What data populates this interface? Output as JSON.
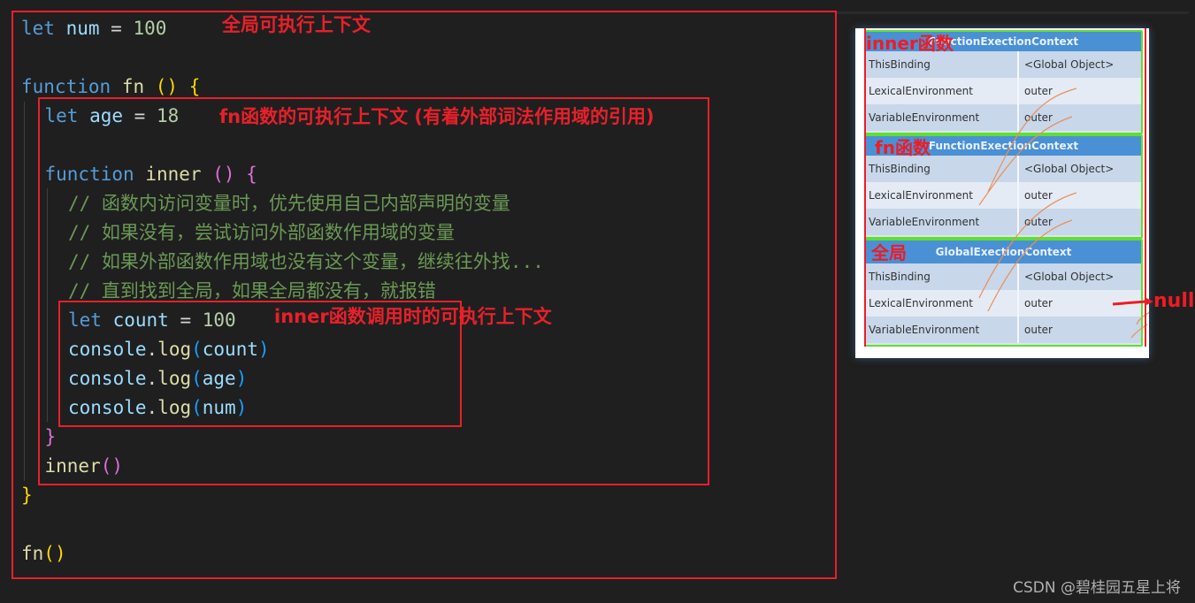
{
  "editor": {
    "lines": [
      {
        "indent": 0,
        "tokens": [
          {
            "t": "let",
            "c": "kw"
          },
          {
            "t": " "
          },
          {
            "t": "num",
            "c": "var"
          },
          {
            "t": " = "
          },
          {
            "t": "100",
            "c": "num"
          }
        ]
      },
      {
        "indent": 0,
        "tokens": []
      },
      {
        "indent": 0,
        "tokens": [
          {
            "t": "function",
            "c": "kw"
          },
          {
            "t": " "
          },
          {
            "t": "fn",
            "c": "fn"
          },
          {
            "t": " "
          },
          {
            "t": "()",
            "c": "b1"
          },
          {
            "t": " "
          },
          {
            "t": "{",
            "c": "b1"
          }
        ]
      },
      {
        "indent": 1,
        "tokens": [
          {
            "t": "let",
            "c": "kw"
          },
          {
            "t": " "
          },
          {
            "t": "age",
            "c": "var"
          },
          {
            "t": " = "
          },
          {
            "t": "18",
            "c": "num"
          }
        ]
      },
      {
        "indent": 0,
        "tokens": []
      },
      {
        "indent": 1,
        "tokens": [
          {
            "t": "function",
            "c": "kw"
          },
          {
            "t": " "
          },
          {
            "t": "inner",
            "c": "fn"
          },
          {
            "t": " "
          },
          {
            "t": "()",
            "c": "b2"
          },
          {
            "t": " "
          },
          {
            "t": "{",
            "c": "b2"
          }
        ]
      },
      {
        "indent": 2,
        "tokens": [
          {
            "t": "// 函数内访问变量时，优先使用自己内部声明的变量",
            "c": "cm"
          }
        ]
      },
      {
        "indent": 2,
        "tokens": [
          {
            "t": "// 如果没有，尝试访问外部函数作用域的变量",
            "c": "cm"
          }
        ]
      },
      {
        "indent": 2,
        "tokens": [
          {
            "t": "// 如果外部函数作用域也没有这个变量，继续往外找...",
            "c": "cm"
          }
        ]
      },
      {
        "indent": 2,
        "tokens": [
          {
            "t": "// 直到找到全局，如果全局都没有，就报错",
            "c": "cm"
          }
        ]
      },
      {
        "indent": 2,
        "tokens": [
          {
            "t": "let",
            "c": "kw"
          },
          {
            "t": " "
          },
          {
            "t": "count",
            "c": "var"
          },
          {
            "t": " = "
          },
          {
            "t": "100",
            "c": "num"
          }
        ]
      },
      {
        "indent": 2,
        "tokens": [
          {
            "t": "console",
            "c": "var"
          },
          {
            "t": "."
          },
          {
            "t": "log",
            "c": "fn"
          },
          {
            "t": "(",
            "c": "b3"
          },
          {
            "t": "count",
            "c": "var"
          },
          {
            "t": ")",
            "c": "b3"
          }
        ]
      },
      {
        "indent": 2,
        "tokens": [
          {
            "t": "console",
            "c": "var"
          },
          {
            "t": "."
          },
          {
            "t": "log",
            "c": "fn"
          },
          {
            "t": "(",
            "c": "b3"
          },
          {
            "t": "age",
            "c": "var"
          },
          {
            "t": ")",
            "c": "b3"
          }
        ]
      },
      {
        "indent": 2,
        "tokens": [
          {
            "t": "console",
            "c": "var"
          },
          {
            "t": "."
          },
          {
            "t": "log",
            "c": "fn"
          },
          {
            "t": "(",
            "c": "b3"
          },
          {
            "t": "num",
            "c": "var"
          },
          {
            "t": ")",
            "c": "b3"
          }
        ]
      },
      {
        "indent": 1,
        "tokens": [
          {
            "t": "}",
            "c": "b2"
          }
        ]
      },
      {
        "indent": 1,
        "tokens": [
          {
            "t": "inner",
            "c": "fn"
          },
          {
            "t": "()",
            "c": "b2"
          }
        ]
      },
      {
        "indent": 0,
        "tokens": [
          {
            "t": "}",
            "c": "b1"
          }
        ]
      },
      {
        "indent": 0,
        "tokens": []
      },
      {
        "indent": 0,
        "tokens": [
          {
            "t": "fn",
            "c": "fn"
          },
          {
            "t": "()",
            "c": "b1"
          }
        ]
      }
    ]
  },
  "annotations": {
    "global_context": "全局可执行上下文",
    "fn_context": "fn函数的可执行上下文 (有着外部词法作用域的引用)",
    "inner_context": "inner函数调用时的可执行上下文",
    "annotation_color": "#e8202a"
  },
  "diagram": {
    "contexts": [
      {
        "label": "inner函数",
        "header": "FunctionExectionContext",
        "rows": [
          {
            "key": "ThisBinding",
            "value": "<Global Object>"
          },
          {
            "key": "LexicalEnvironment",
            "value": "outer"
          },
          {
            "key": "VariableEnvironment",
            "value": "outer"
          }
        ]
      },
      {
        "label": "fn函数",
        "header": "FunctionExectionContext",
        "rows": [
          {
            "key": "ThisBinding",
            "value": "<Global Object>"
          },
          {
            "key": "LexicalEnvironment",
            "value": "outer"
          },
          {
            "key": "VariableEnvironment",
            "value": "outer"
          }
        ]
      },
      {
        "label": "全局",
        "header": "GlobalExectionContext",
        "rows": [
          {
            "key": "ThisBinding",
            "value": "<Global Object>"
          },
          {
            "key": "LexicalEnvironment",
            "value": "outer"
          },
          {
            "key": "VariableEnvironment",
            "value": "outer"
          }
        ]
      }
    ],
    "null_label": "null"
  },
  "watermark": "CSDN @碧桂园五星上将"
}
